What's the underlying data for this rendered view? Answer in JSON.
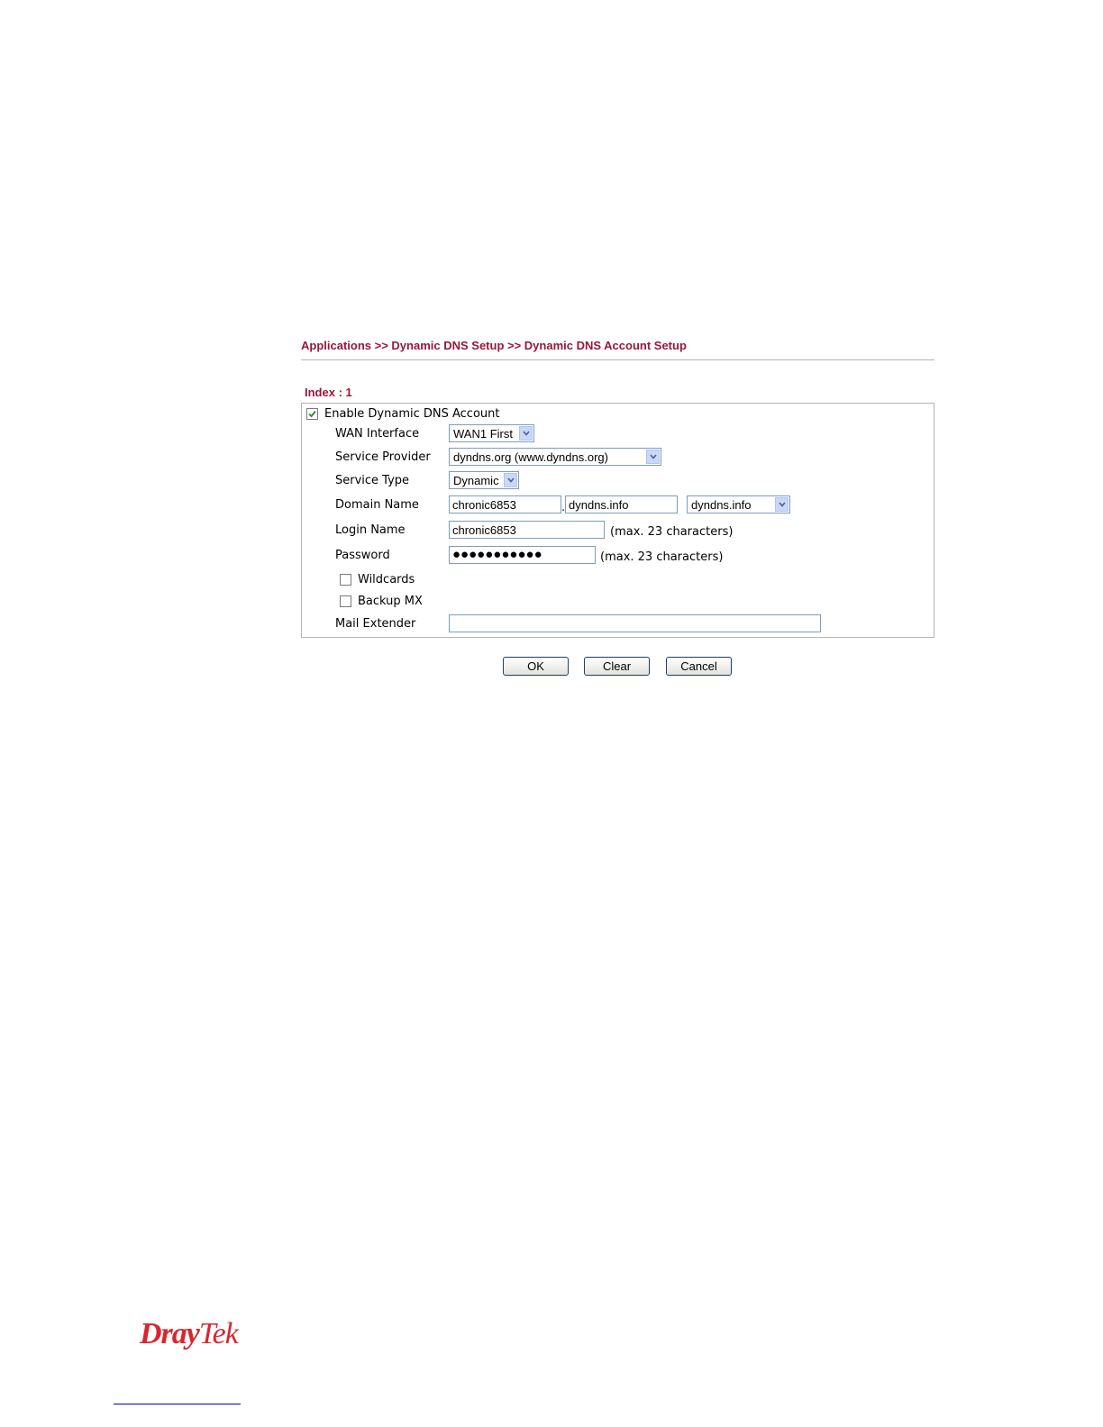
{
  "header": {
    "breadcrumb": "Applications >> Dynamic DNS Setup >> Dynamic DNS Account Setup",
    "index_label": "Index : 1"
  },
  "form": {
    "enable": {
      "label": "Enable Dynamic DNS Account",
      "checked": true
    },
    "wan_interface": {
      "label": "WAN Interface",
      "value": "WAN1 First"
    },
    "service_provider": {
      "label": "Service Provider",
      "value": "dyndns.org (www.dyndns.org)"
    },
    "service_type": {
      "label": "Service Type",
      "value": "Dynamic"
    },
    "domain_name": {
      "label": "Domain Name",
      "host": "chronic6853",
      "separator": ".",
      "domain": "dyndns.info",
      "domain_select": "dyndns.info"
    },
    "login_name": {
      "label": "Login Name",
      "value": "chronic6853",
      "note": "(max. 23 characters)"
    },
    "password": {
      "label": "Password",
      "masked": "●●●●●●●●●●●",
      "note": "(max. 23 characters)"
    },
    "wildcards": {
      "label": "Wildcards",
      "checked": false
    },
    "backup_mx": {
      "label": "Backup MX",
      "checked": false
    },
    "mail_extender": {
      "label": "Mail Extender",
      "value": ""
    }
  },
  "buttons": {
    "ok": "OK",
    "clear": "Clear",
    "cancel": "Cancel"
  },
  "brand": {
    "part1": "Dray",
    "part2": "Tek",
    "color": "#d8262f"
  },
  "colors": {
    "title": "#98173a",
    "border": "#b4b4b4",
    "input_border": "#7f9db9",
    "check_mark": "#2f8a2f"
  },
  "icons": [
    "checkbox-checked-icon",
    "chevron-down-icon"
  ]
}
